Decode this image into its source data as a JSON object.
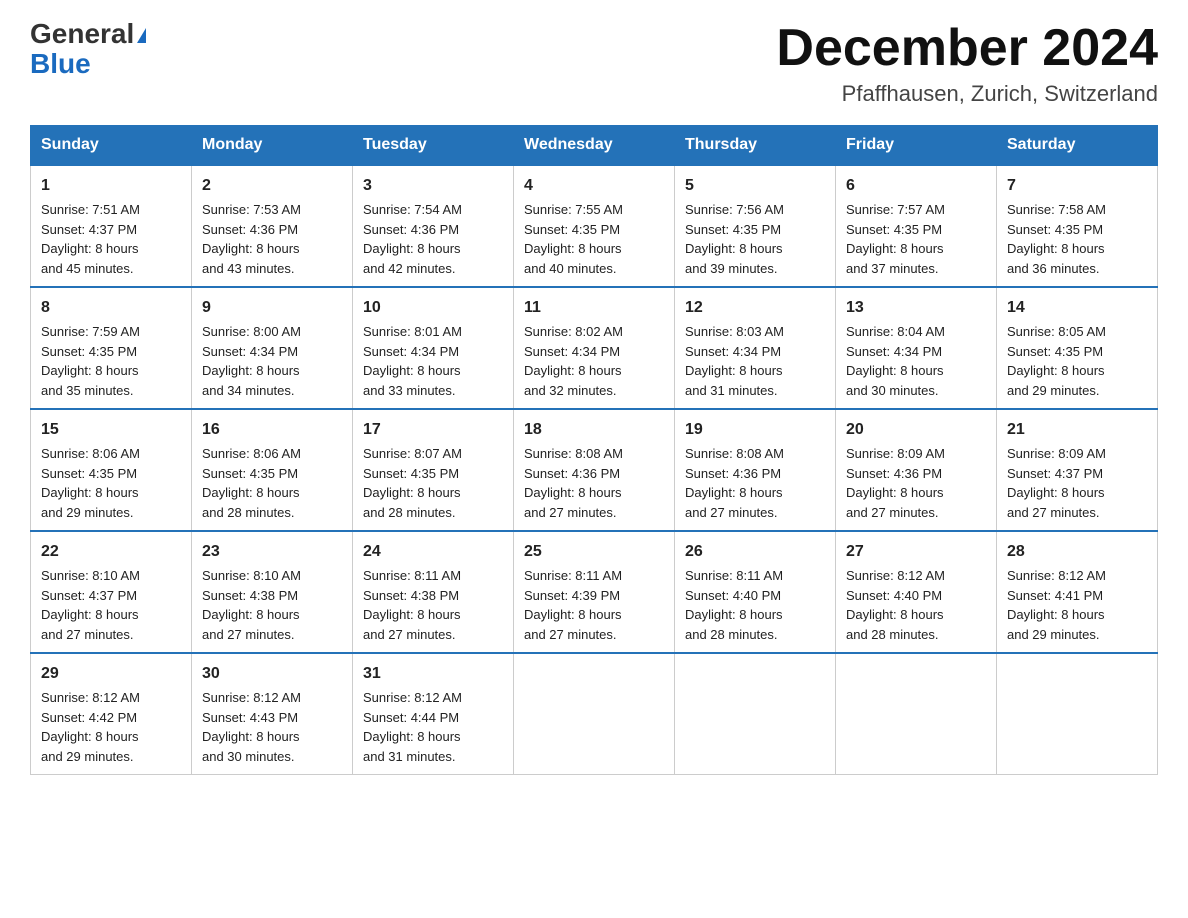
{
  "header": {
    "logo_general": "General",
    "logo_blue": "Blue",
    "month_title": "December 2024",
    "location": "Pfaffhausen, Zurich, Switzerland"
  },
  "days_of_week": [
    "Sunday",
    "Monday",
    "Tuesday",
    "Wednesday",
    "Thursday",
    "Friday",
    "Saturday"
  ],
  "weeks": [
    [
      {
        "day": "1",
        "sunrise": "7:51 AM",
        "sunset": "4:37 PM",
        "daylight": "8 hours and 45 minutes."
      },
      {
        "day": "2",
        "sunrise": "7:53 AM",
        "sunset": "4:36 PM",
        "daylight": "8 hours and 43 minutes."
      },
      {
        "day": "3",
        "sunrise": "7:54 AM",
        "sunset": "4:36 PM",
        "daylight": "8 hours and 42 minutes."
      },
      {
        "day": "4",
        "sunrise": "7:55 AM",
        "sunset": "4:35 PM",
        "daylight": "8 hours and 40 minutes."
      },
      {
        "day": "5",
        "sunrise": "7:56 AM",
        "sunset": "4:35 PM",
        "daylight": "8 hours and 39 minutes."
      },
      {
        "day": "6",
        "sunrise": "7:57 AM",
        "sunset": "4:35 PM",
        "daylight": "8 hours and 37 minutes."
      },
      {
        "day": "7",
        "sunrise": "7:58 AM",
        "sunset": "4:35 PM",
        "daylight": "8 hours and 36 minutes."
      }
    ],
    [
      {
        "day": "8",
        "sunrise": "7:59 AM",
        "sunset": "4:35 PM",
        "daylight": "8 hours and 35 minutes."
      },
      {
        "day": "9",
        "sunrise": "8:00 AM",
        "sunset": "4:34 PM",
        "daylight": "8 hours and 34 minutes."
      },
      {
        "day": "10",
        "sunrise": "8:01 AM",
        "sunset": "4:34 PM",
        "daylight": "8 hours and 33 minutes."
      },
      {
        "day": "11",
        "sunrise": "8:02 AM",
        "sunset": "4:34 PM",
        "daylight": "8 hours and 32 minutes."
      },
      {
        "day": "12",
        "sunrise": "8:03 AM",
        "sunset": "4:34 PM",
        "daylight": "8 hours and 31 minutes."
      },
      {
        "day": "13",
        "sunrise": "8:04 AM",
        "sunset": "4:34 PM",
        "daylight": "8 hours and 30 minutes."
      },
      {
        "day": "14",
        "sunrise": "8:05 AM",
        "sunset": "4:35 PM",
        "daylight": "8 hours and 29 minutes."
      }
    ],
    [
      {
        "day": "15",
        "sunrise": "8:06 AM",
        "sunset": "4:35 PM",
        "daylight": "8 hours and 29 minutes."
      },
      {
        "day": "16",
        "sunrise": "8:06 AM",
        "sunset": "4:35 PM",
        "daylight": "8 hours and 28 minutes."
      },
      {
        "day": "17",
        "sunrise": "8:07 AM",
        "sunset": "4:35 PM",
        "daylight": "8 hours and 28 minutes."
      },
      {
        "day": "18",
        "sunrise": "8:08 AM",
        "sunset": "4:36 PM",
        "daylight": "8 hours and 27 minutes."
      },
      {
        "day": "19",
        "sunrise": "8:08 AM",
        "sunset": "4:36 PM",
        "daylight": "8 hours and 27 minutes."
      },
      {
        "day": "20",
        "sunrise": "8:09 AM",
        "sunset": "4:36 PM",
        "daylight": "8 hours and 27 minutes."
      },
      {
        "day": "21",
        "sunrise": "8:09 AM",
        "sunset": "4:37 PM",
        "daylight": "8 hours and 27 minutes."
      }
    ],
    [
      {
        "day": "22",
        "sunrise": "8:10 AM",
        "sunset": "4:37 PM",
        "daylight": "8 hours and 27 minutes."
      },
      {
        "day": "23",
        "sunrise": "8:10 AM",
        "sunset": "4:38 PM",
        "daylight": "8 hours and 27 minutes."
      },
      {
        "day": "24",
        "sunrise": "8:11 AM",
        "sunset": "4:38 PM",
        "daylight": "8 hours and 27 minutes."
      },
      {
        "day": "25",
        "sunrise": "8:11 AM",
        "sunset": "4:39 PM",
        "daylight": "8 hours and 27 minutes."
      },
      {
        "day": "26",
        "sunrise": "8:11 AM",
        "sunset": "4:40 PM",
        "daylight": "8 hours and 28 minutes."
      },
      {
        "day": "27",
        "sunrise": "8:12 AM",
        "sunset": "4:40 PM",
        "daylight": "8 hours and 28 minutes."
      },
      {
        "day": "28",
        "sunrise": "8:12 AM",
        "sunset": "4:41 PM",
        "daylight": "8 hours and 29 minutes."
      }
    ],
    [
      {
        "day": "29",
        "sunrise": "8:12 AM",
        "sunset": "4:42 PM",
        "daylight": "8 hours and 29 minutes."
      },
      {
        "day": "30",
        "sunrise": "8:12 AM",
        "sunset": "4:43 PM",
        "daylight": "8 hours and 30 minutes."
      },
      {
        "day": "31",
        "sunrise": "8:12 AM",
        "sunset": "4:44 PM",
        "daylight": "8 hours and 31 minutes."
      },
      null,
      null,
      null,
      null
    ]
  ],
  "labels": {
    "sunrise": "Sunrise:",
    "sunset": "Sunset:",
    "daylight": "Daylight:"
  }
}
